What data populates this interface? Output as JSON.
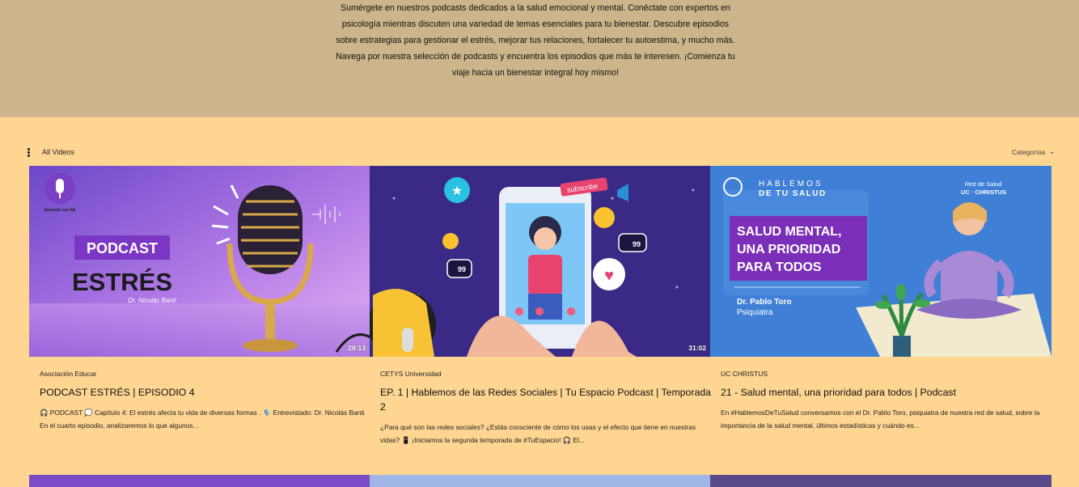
{
  "intro": {
    "line1": "Sumérgete en nuestros podcasts dedicados a la salud emocional y mental. Conéctate con expertos en psicología mientras discuten una variedad de temas esenciales para tu bienestar. Descubre episodios sobre estrategias para gestionar el estrés, mejorar tus relaciones, fortalecer tu autoestima, y mucho más.",
    "line2": "Navega por nuestra selección de podcasts y encuentra los episodios que más te interesen. ¡Comienza tu viaje hacia un bienestar integral hoy mismo!"
  },
  "toolbar": {
    "all_videos": "All Videos",
    "categories": "Categorías",
    "menu_icon": "more-vertical-icon",
    "categories_icon": "chevron-down-icon"
  },
  "videos": [
    {
      "channel": "Asociación Educar",
      "title": "PODCAST ESTRÉS | EPISODIO 4",
      "description": "🎧 PODCAST 💭 Capítulo 4: El estrés afecta tu vida de diversas formas . 🎙️ Entrevistado: Dr. Nicolás Banti En el cuarto episodio, analizaremos lo que algunos...",
      "duration": "28:13",
      "thumb": {
        "logo_caption": "Aprende con AE",
        "badge": "PODCAST",
        "headline": "ESTRÉS",
        "doctor": "Dr. Nicolás Banti"
      }
    },
    {
      "channel": "CETYS Universidad",
      "title": "EP. 1 | Hablemos de las Redes Sociales | Tu Espacio Podcast | Temporada 2",
      "description": "¿Para qué son las redes sociales? ¿Estás consciente de cómo los usas y el efecto que tiene en nuestras vidas? 📱 ¡Iniciamos la segunda temporada de #TuEspacio! 🎧 El...",
      "duration": "31:02",
      "thumb": {
        "subscribe": "subscribe",
        "count_a": "99",
        "count_b": "99"
      }
    },
    {
      "channel": "UC CHRISTUS",
      "title": "21 - Salud mental, una prioridad para todos | Podcast",
      "description": "En #HablemosDeTuSalud conversamos con el Dr. Pablo Toro, psiquiatra de nuestra red de salud, sobre la importancia de la salud mental, últimos estadísticas y cuándo es...",
      "duration": "",
      "thumb": {
        "brand_line1": "HABLEMOS",
        "brand_line2": "DE TU SALUD",
        "partner_line1": "Red de Salud",
        "partner_line2": "UC · CHRISTUS",
        "headline_1": "SALUD MENTAL,",
        "headline_2": "UNA PRIORIDAD",
        "headline_3": "PARA TODOS",
        "doctor": "Dr. Pablo Toro",
        "role": "Psiquiatra"
      }
    }
  ],
  "colors": {
    "intro_bg": "#ccb58a",
    "page_bg": "#ffd592",
    "purple": "#8a4fd1",
    "indigo": "#3b2a7a",
    "blue": "#3f7fd6"
  }
}
